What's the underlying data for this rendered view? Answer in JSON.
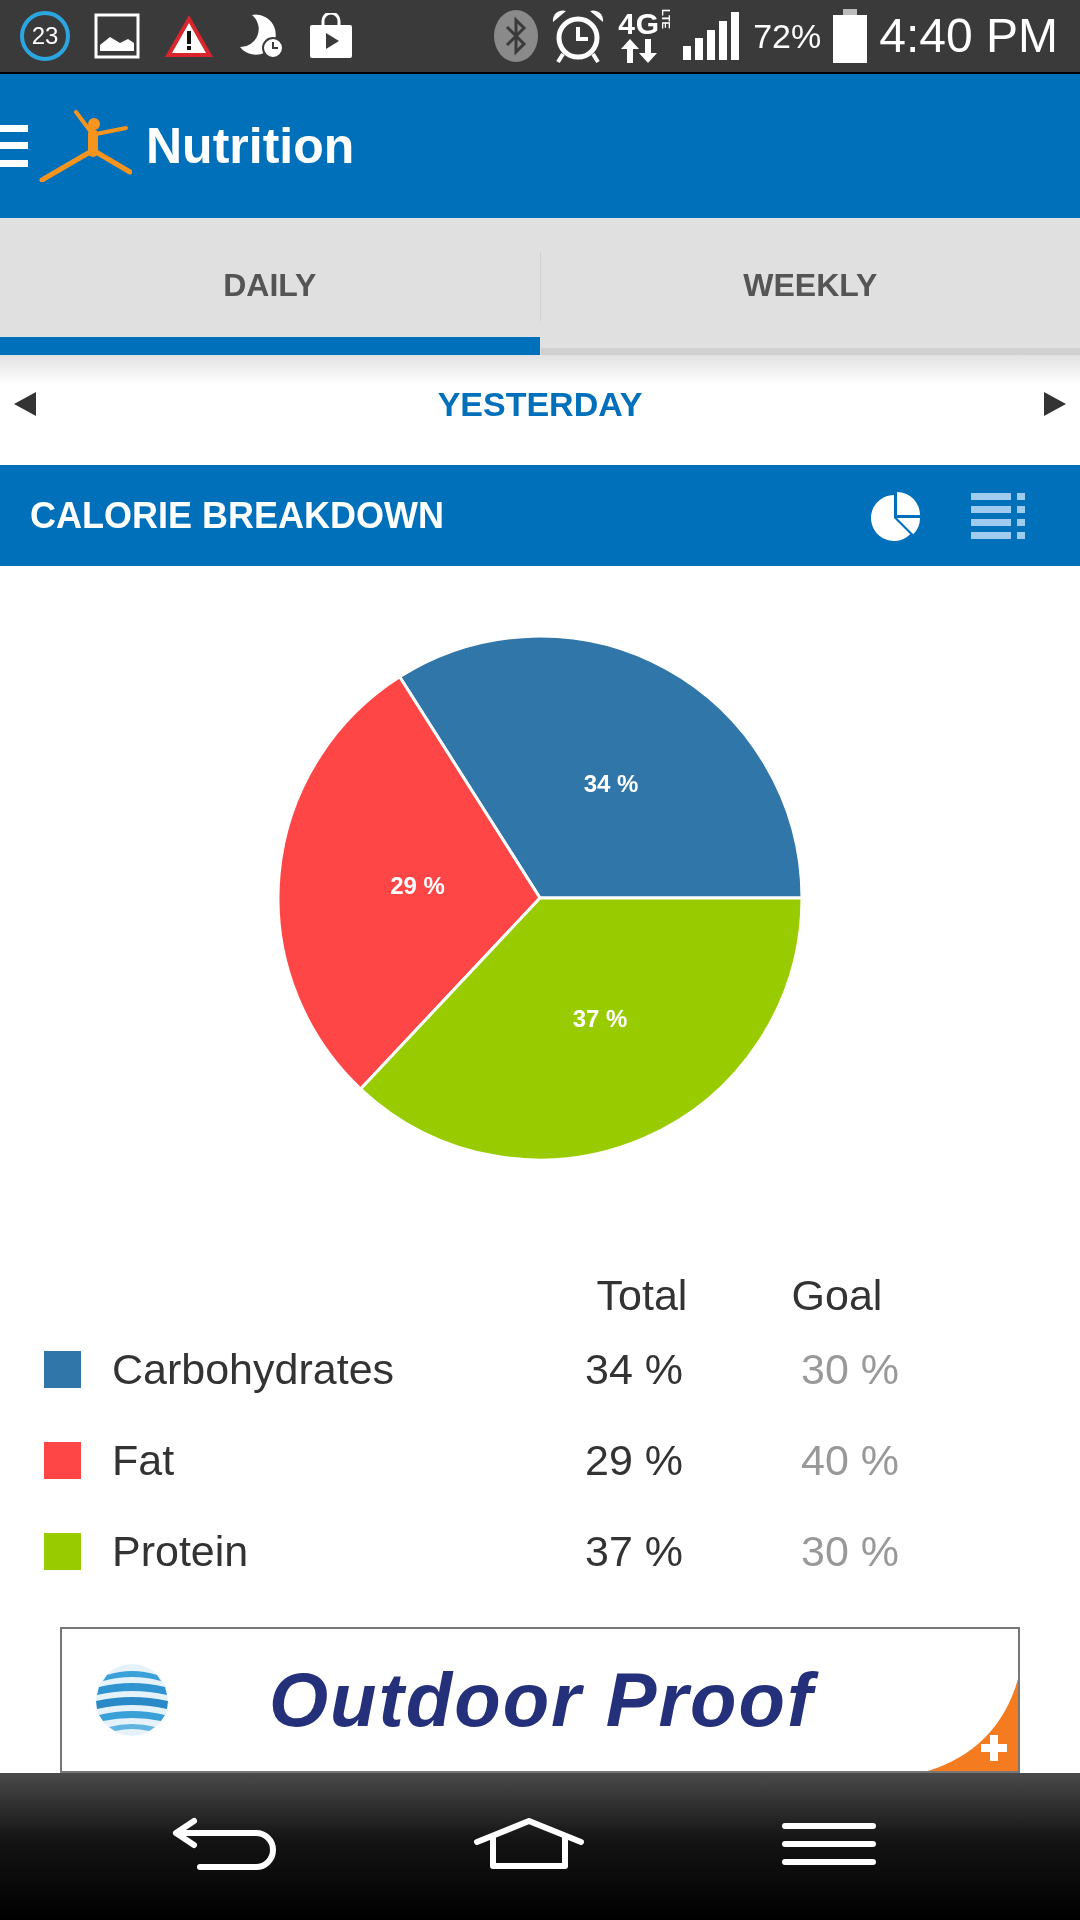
{
  "status_bar": {
    "notification_count": "23",
    "network": "4G",
    "network_sub": "LTE",
    "battery": "72%",
    "time": "4:40 PM"
  },
  "app_bar": {
    "title": "Nutrition"
  },
  "tabs": [
    {
      "label": "DAILY",
      "selected": true
    },
    {
      "label": "WEEKLY",
      "selected": false
    }
  ],
  "date_nav": {
    "label": "YESTERDAY"
  },
  "breakdown": {
    "title": "CALORIE BREAKDOWN",
    "views": [
      {
        "kind": "pie",
        "selected": true
      },
      {
        "kind": "list",
        "selected": false
      }
    ],
    "chart_data": {
      "type": "pie",
      "categories": [
        "Carbohydrates",
        "Fat",
        "Protein"
      ],
      "values": [
        34,
        29,
        37
      ],
      "value_labels": [
        "34 %",
        "29 %",
        "37 %"
      ]
    },
    "legend": {
      "columns": [
        "Total",
        "Goal"
      ],
      "rows": [
        {
          "color": "#3076a9",
          "total": "34 %",
          "goal": "30 %"
        },
        {
          "color": "#ff4646",
          "total": "29 %",
          "goal": "40 %"
        },
        {
          "color": "#99cc00",
          "total": "37 %",
          "goal": "30 %"
        }
      ]
    }
  },
  "ad": {
    "text": "Outdoor Proof"
  }
}
